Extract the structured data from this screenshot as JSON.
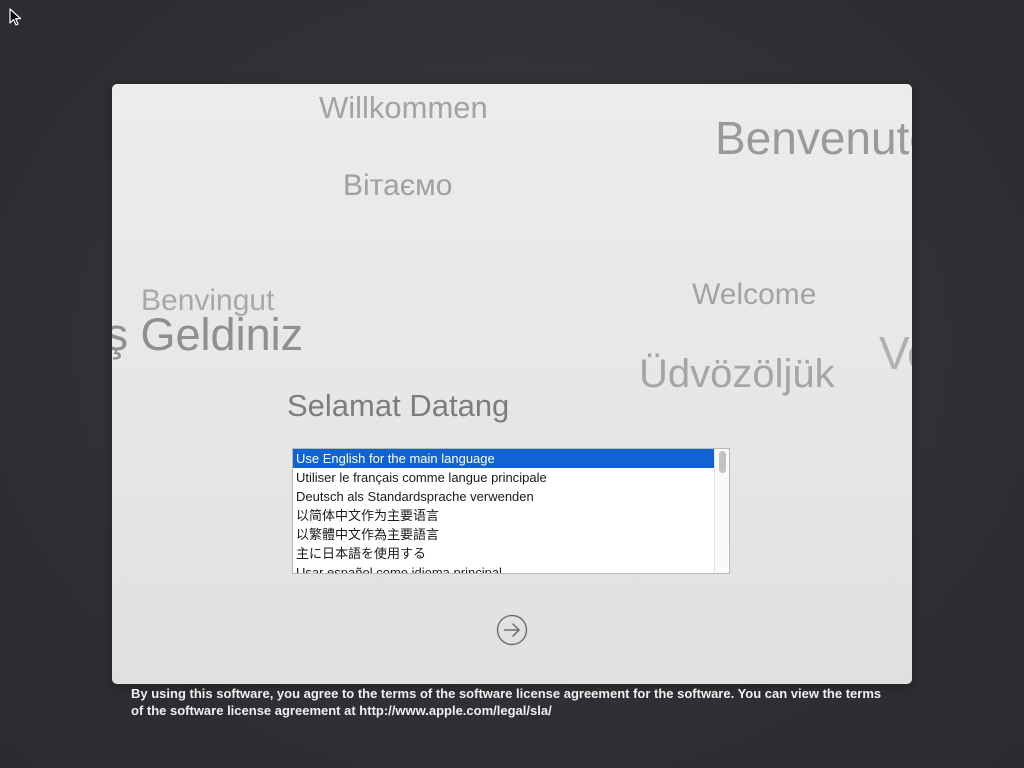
{
  "greetings": {
    "willkommen": "Willkommen",
    "benvenuto": "Benvenuto",
    "vitaemo": "Вітаємо",
    "benvingut": "Benvingut",
    "hos_geldiniz": "Hoş Geldiniz",
    "welcome": "Welcome",
    "udvozoljuk": "Üdvözöljük",
    "partial_ve": "Ve",
    "selamat_datang": "Selamat Datang"
  },
  "language_list": {
    "selected_index": 0,
    "items": [
      "Use English for the main language",
      "Utiliser le français comme langue principale",
      "Deutsch als Standardsprache verwenden",
      "以简体中文作为主要语言",
      "以繁體中文作為主要語言",
      "主に日本語を使用する",
      "Usar español como idioma principal"
    ]
  },
  "icons": {
    "cursor": "arrow-pointer-icon",
    "next": "circled-arrow-right-icon"
  },
  "license_text": "By using this software, you agree to the terms of the software license agreement for the software. You can view the terms of the software license agreement at http://www.apple.com/legal/sla/",
  "colors": {
    "desktop_background": "#2f3034",
    "panel_background": "#e8e8e8",
    "selection": "#0f64d2"
  }
}
